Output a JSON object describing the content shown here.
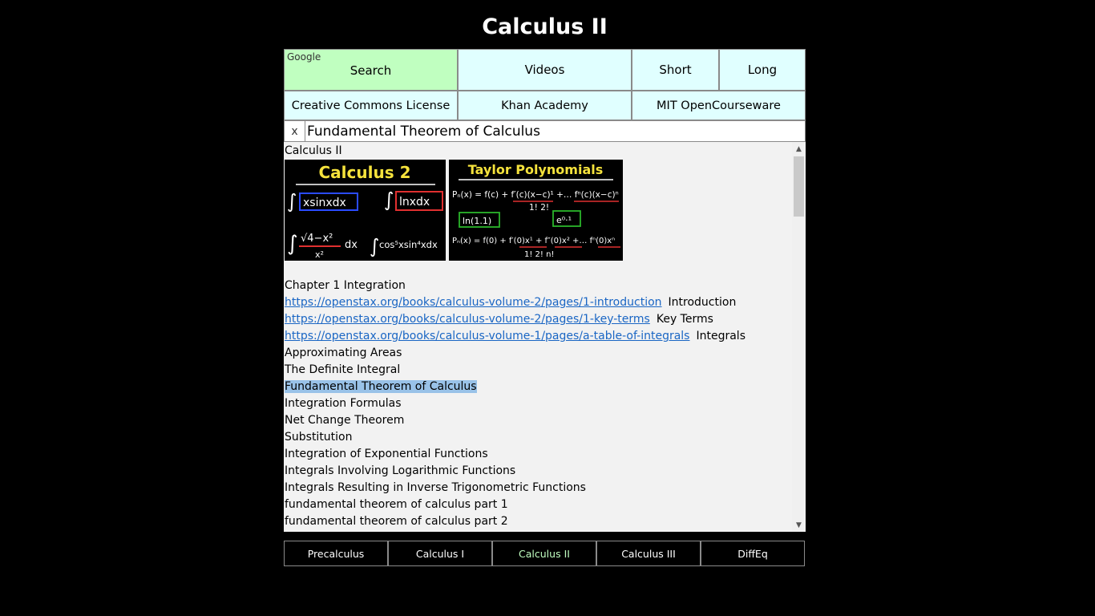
{
  "app": {
    "title": "Calculus II"
  },
  "nav_row1": {
    "google_tag": "Google",
    "search": "Search",
    "videos": "Videos",
    "short": "Short",
    "long": "Long"
  },
  "nav_row2": {
    "creative_commons": "Creative Commons License",
    "khan": "Khan Academy",
    "mit": "MIT OpenCourseware"
  },
  "search": {
    "clear_label": "x",
    "value": "Fundamental Theorem of Calculus"
  },
  "content": {
    "heading": "Calculus II",
    "thumb1": {
      "title": "Calculus 2",
      "f1": "∫",
      "e1": "xsinxdx",
      "f2": "∫",
      "e2": "lnxdx",
      "f3": "∫",
      "e3a": "√4−x²",
      "e3b": "x²",
      "e3c": "dx",
      "f4": "∫",
      "e4": "cos⁵xsin⁴xdx"
    },
    "thumb2": {
      "title": "Taylor Polynomials",
      "l1": "Pₙ(x) = f(c) + f′(c)(x−c)¹ +… fⁿ(c)(x−c)ⁿ",
      "l1d": "1!                        2!",
      "box1": "ln(1.1)",
      "box2": "e⁰·¹",
      "l2": "Pₙ(x) = f(0) + f′(0)x¹ + f″(0)x² +… fⁿ(0)xⁿ",
      "l2d": "1!             2!               n!"
    },
    "chapter": "Chapter 1 Integration",
    "links": [
      {
        "url": "https://openstax.org/books/calculus-volume-2/pages/1-introduction",
        "label": "Introduction"
      },
      {
        "url": "https://openstax.org/books/calculus-volume-2/pages/1-key-terms",
        "label": "Key Terms"
      },
      {
        "url": "https://openstax.org/books/calculus-volume-1/pages/a-table-of-integrals",
        "label": "Integrals"
      }
    ],
    "items": [
      "Approximating Areas",
      "The Definite Integral",
      "Fundamental Theorem of Calculus",
      "Integration Formulas",
      "Net Change Theorem",
      "Substitution",
      "Integration of Exponential Functions",
      "Integrals Involving Logarithmic Functions",
      "Integrals Resulting in Inverse Trigonometric Functions",
      "fundamental theorem of calculus part 1",
      "fundamental theorem of calculus part 2"
    ]
  },
  "scrollbar": {
    "up": "▲",
    "down": "▼"
  },
  "tabs": {
    "precalc": "Precalculus",
    "calc1": "Calculus I",
    "calc2": "Calculus II",
    "calc3": "Calculus III",
    "diffeq": "DiffEq"
  },
  "colors": {
    "background": "#000000",
    "google_cell": "#c0ffc0",
    "nav_cell": "#e0ffff",
    "link": "#1a66c4",
    "selection": "#99c2e8",
    "active_tab": "#c0ffc0"
  }
}
